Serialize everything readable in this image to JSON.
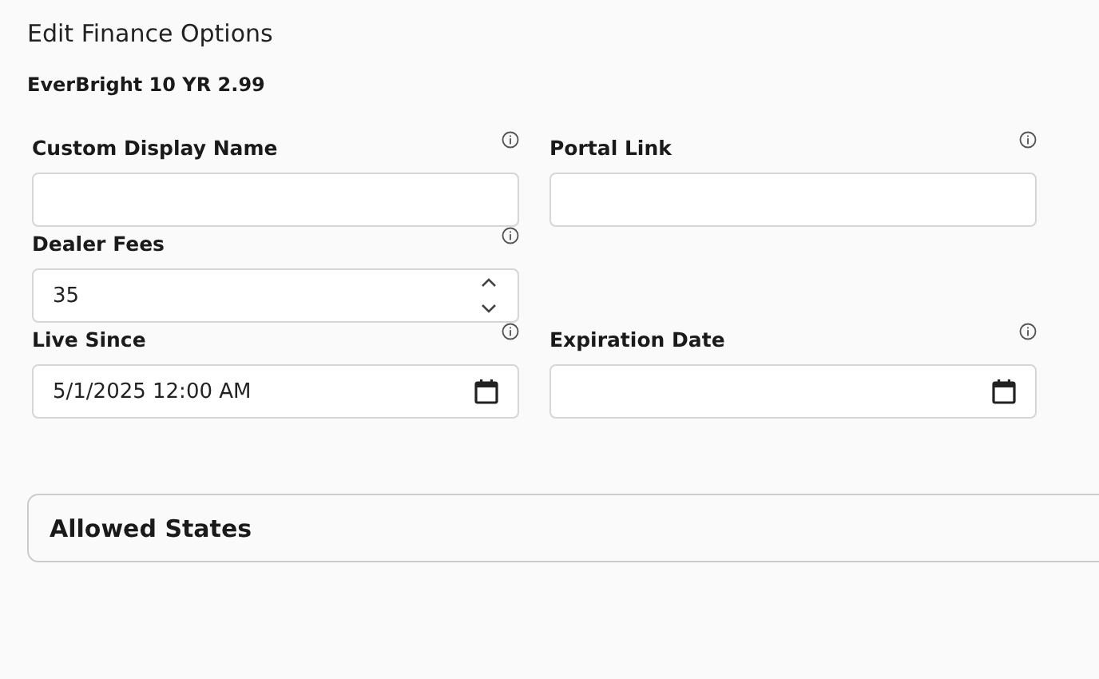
{
  "title": "Edit Finance Options",
  "subtitle": "EverBright 10 YR 2.99",
  "rows": [
    [
      {
        "label": "Custom Display Name",
        "kind": "text"
      },
      {
        "label": "Portal Link",
        "kind": "text"
      }
    ],
    [
      {
        "label": "Dealer Fees",
        "kind": "number",
        "value": "35"
      }
    ],
    [
      {
        "label": "Live Since",
        "kind": "datetime",
        "value": "5/1/2025 12:00 AM"
      },
      {
        "label": "Expiration Date",
        "kind": "datetime"
      }
    ]
  ],
  "section": {
    "title": "Allowed States"
  }
}
